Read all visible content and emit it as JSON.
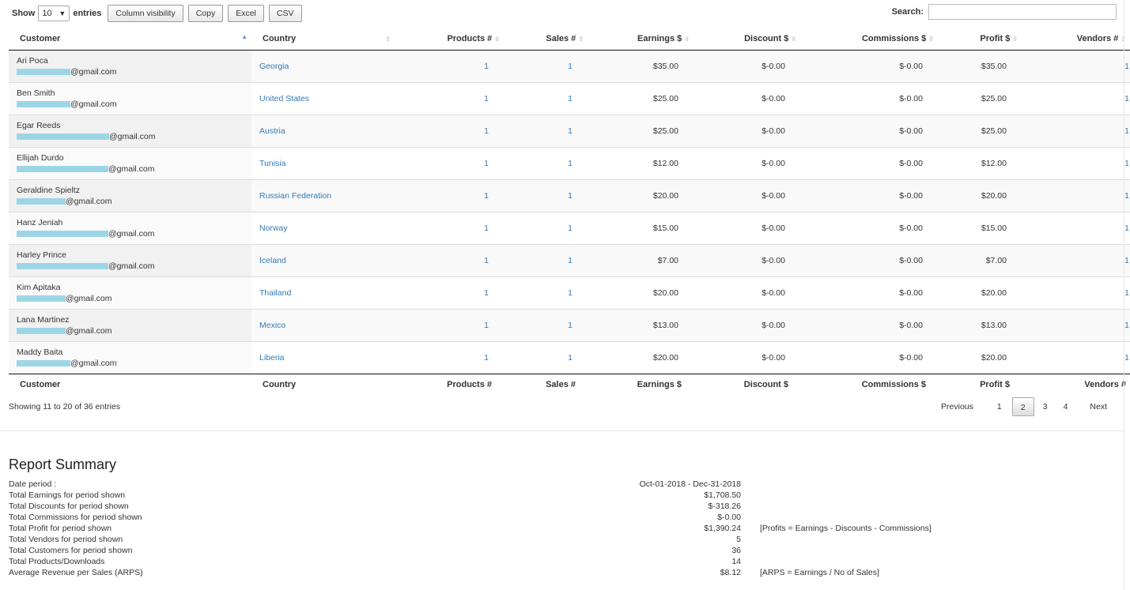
{
  "controls": {
    "show_label": "Show",
    "entries_label": "entries",
    "length_value": "10",
    "buttons": [
      "Column visibility",
      "Copy",
      "Excel",
      "CSV"
    ],
    "search_label": "Search:",
    "search_value": ""
  },
  "columns": [
    "Customer",
    "Country",
    "Products #",
    "Sales #",
    "Earnings $",
    "Discount $",
    "Commissions $",
    "Profit $",
    "Vendors #"
  ],
  "rows": [
    {
      "name": "Ari Poca",
      "email": "@gmail.com",
      "country": "Georgia",
      "products": "1",
      "sales": "1",
      "earnings": "$35.00",
      "discount": "$-0.00",
      "commissions": "$-0.00",
      "profit": "$35.00",
      "vendors": "1"
    },
    {
      "name": "Ben Smith",
      "email": "@gmail.com",
      "country": "United States",
      "products": "1",
      "sales": "1",
      "earnings": "$25.00",
      "discount": "$-0.00",
      "commissions": "$-0.00",
      "profit": "$25.00",
      "vendors": "1"
    },
    {
      "name": "Egar Reeds",
      "email": "@gmail.com",
      "country": "Austria",
      "products": "1",
      "sales": "1",
      "earnings": "$25.00",
      "discount": "$-0.00",
      "commissions": "$-0.00",
      "profit": "$25.00",
      "vendors": "1"
    },
    {
      "name": "Ellijah Durdo",
      "email": "@gmail.com",
      "country": "Tunisia",
      "products": "1",
      "sales": "1",
      "earnings": "$12.00",
      "discount": "$-0.00",
      "commissions": "$-0.00",
      "profit": "$12.00",
      "vendors": "1"
    },
    {
      "name": "Geraldine Spieltz",
      "email": "@gmail.com",
      "country": "Russian Federation",
      "products": "1",
      "sales": "1",
      "earnings": "$20.00",
      "discount": "$-0.00",
      "commissions": "$-0.00",
      "profit": "$20.00",
      "vendors": "1"
    },
    {
      "name": "Hanz Jeniah",
      "email": "@gmail.com",
      "country": "Norway",
      "products": "1",
      "sales": "1",
      "earnings": "$15.00",
      "discount": "$-0.00",
      "commissions": "$-0.00",
      "profit": "$15.00",
      "vendors": "1"
    },
    {
      "name": "Harley Prince",
      "email": "@gmail.com",
      "country": "Iceland",
      "products": "1",
      "sales": "1",
      "earnings": "$7.00",
      "discount": "$-0.00",
      "commissions": "$-0.00",
      "profit": "$7.00",
      "vendors": "1"
    },
    {
      "name": "Kim Apitaka",
      "email": "@gmail.com",
      "country": "Thailand",
      "products": "1",
      "sales": "1",
      "earnings": "$20.00",
      "discount": "$-0.00",
      "commissions": "$-0.00",
      "profit": "$20.00",
      "vendors": "1"
    },
    {
      "name": "Lana Martinez",
      "email": "@gmail.com",
      "country": "Mexico",
      "products": "1",
      "sales": "1",
      "earnings": "$13.00",
      "discount": "$-0.00",
      "commissions": "$-0.00",
      "profit": "$13.00",
      "vendors": "1"
    },
    {
      "name": "Maddy Baita",
      "email": "@gmail.com",
      "country": "Liberia",
      "products": "1",
      "sales": "1",
      "earnings": "$20.00",
      "discount": "$-0.00",
      "commissions": "$-0.00",
      "profit": "$20.00",
      "vendors": "1"
    }
  ],
  "info": "Showing 11 to 20 of 36 entries",
  "pagination": {
    "previous": "Previous",
    "pages": [
      "1",
      "2",
      "3",
      "4"
    ],
    "current": "2",
    "next": "Next"
  },
  "summary": {
    "title": "Report Summary",
    "rows": [
      {
        "label": "Date period :",
        "value": "Oct-01-2018 - Dec-31-2018",
        "note": ""
      },
      {
        "label": "Total Earnings for period shown",
        "value": "$1,708.50",
        "note": ""
      },
      {
        "label": "Total Discounts for period shown",
        "value": "$-318.26",
        "note": ""
      },
      {
        "label": "Total Commissions for period shown",
        "value": "$-0.00",
        "note": ""
      },
      {
        "label": "Total Profit for period shown",
        "value": "$1,390.24",
        "note": "[Profits = Earnings - Discounts - Commissions]"
      },
      {
        "label": "Total Vendors for period shown",
        "value": "5",
        "note": ""
      },
      {
        "label": "Total Customers for period shown",
        "value": "36",
        "note": ""
      },
      {
        "label": "Total Products/Downloads",
        "value": "14",
        "note": ""
      },
      {
        "label": "Average Revenue per Sales (ARPS)",
        "value": "$8.12",
        "note": "[ARPS = Earnings / No of Sales]"
      }
    ]
  },
  "colors": {
    "link": "#337ab7",
    "email_mask": "#9cd6e6",
    "sort_active": "#6b8fd6"
  }
}
